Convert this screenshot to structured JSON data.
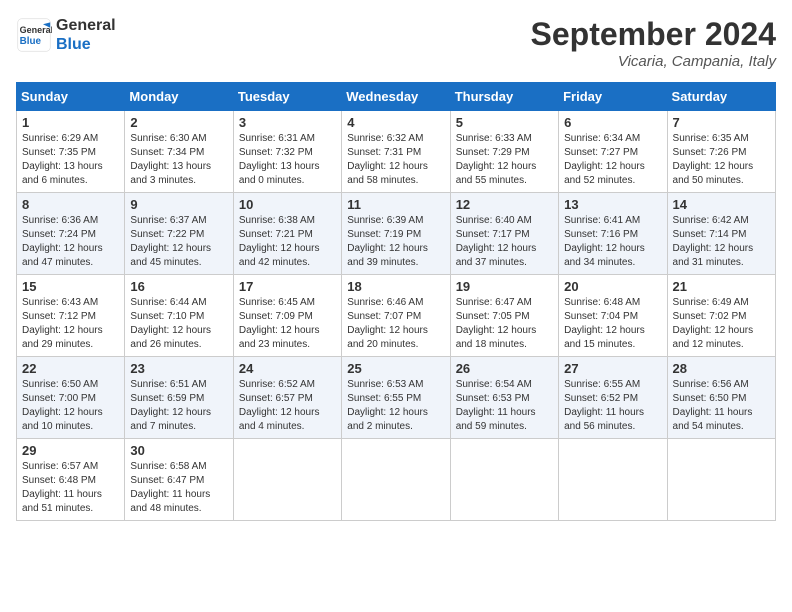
{
  "header": {
    "logo_line1": "General",
    "logo_line2": "Blue",
    "month": "September 2024",
    "location": "Vicaria, Campania, Italy"
  },
  "columns": [
    "Sunday",
    "Monday",
    "Tuesday",
    "Wednesday",
    "Thursday",
    "Friday",
    "Saturday"
  ],
  "weeks": [
    [
      {
        "day": "1",
        "sunrise": "6:29 AM",
        "sunset": "7:35 PM",
        "daylight": "13 hours and 6 minutes."
      },
      {
        "day": "2",
        "sunrise": "6:30 AM",
        "sunset": "7:34 PM",
        "daylight": "13 hours and 3 minutes."
      },
      {
        "day": "3",
        "sunrise": "6:31 AM",
        "sunset": "7:32 PM",
        "daylight": "13 hours and 0 minutes."
      },
      {
        "day": "4",
        "sunrise": "6:32 AM",
        "sunset": "7:31 PM",
        "daylight": "12 hours and 58 minutes."
      },
      {
        "day": "5",
        "sunrise": "6:33 AM",
        "sunset": "7:29 PM",
        "daylight": "12 hours and 55 minutes."
      },
      {
        "day": "6",
        "sunrise": "6:34 AM",
        "sunset": "7:27 PM",
        "daylight": "12 hours and 52 minutes."
      },
      {
        "day": "7",
        "sunrise": "6:35 AM",
        "sunset": "7:26 PM",
        "daylight": "12 hours and 50 minutes."
      }
    ],
    [
      {
        "day": "8",
        "sunrise": "6:36 AM",
        "sunset": "7:24 PM",
        "daylight": "12 hours and 47 minutes."
      },
      {
        "day": "9",
        "sunrise": "6:37 AM",
        "sunset": "7:22 PM",
        "daylight": "12 hours and 45 minutes."
      },
      {
        "day": "10",
        "sunrise": "6:38 AM",
        "sunset": "7:21 PM",
        "daylight": "12 hours and 42 minutes."
      },
      {
        "day": "11",
        "sunrise": "6:39 AM",
        "sunset": "7:19 PM",
        "daylight": "12 hours and 39 minutes."
      },
      {
        "day": "12",
        "sunrise": "6:40 AM",
        "sunset": "7:17 PM",
        "daylight": "12 hours and 37 minutes."
      },
      {
        "day": "13",
        "sunrise": "6:41 AM",
        "sunset": "7:16 PM",
        "daylight": "12 hours and 34 minutes."
      },
      {
        "day": "14",
        "sunrise": "6:42 AM",
        "sunset": "7:14 PM",
        "daylight": "12 hours and 31 minutes."
      }
    ],
    [
      {
        "day": "15",
        "sunrise": "6:43 AM",
        "sunset": "7:12 PM",
        "daylight": "12 hours and 29 minutes."
      },
      {
        "day": "16",
        "sunrise": "6:44 AM",
        "sunset": "7:10 PM",
        "daylight": "12 hours and 26 minutes."
      },
      {
        "day": "17",
        "sunrise": "6:45 AM",
        "sunset": "7:09 PM",
        "daylight": "12 hours and 23 minutes."
      },
      {
        "day": "18",
        "sunrise": "6:46 AM",
        "sunset": "7:07 PM",
        "daylight": "12 hours and 20 minutes."
      },
      {
        "day": "19",
        "sunrise": "6:47 AM",
        "sunset": "7:05 PM",
        "daylight": "12 hours and 18 minutes."
      },
      {
        "day": "20",
        "sunrise": "6:48 AM",
        "sunset": "7:04 PM",
        "daylight": "12 hours and 15 minutes."
      },
      {
        "day": "21",
        "sunrise": "6:49 AM",
        "sunset": "7:02 PM",
        "daylight": "12 hours and 12 minutes."
      }
    ],
    [
      {
        "day": "22",
        "sunrise": "6:50 AM",
        "sunset": "7:00 PM",
        "daylight": "12 hours and 10 minutes."
      },
      {
        "day": "23",
        "sunrise": "6:51 AM",
        "sunset": "6:59 PM",
        "daylight": "12 hours and 7 minutes."
      },
      {
        "day": "24",
        "sunrise": "6:52 AM",
        "sunset": "6:57 PM",
        "daylight": "12 hours and 4 minutes."
      },
      {
        "day": "25",
        "sunrise": "6:53 AM",
        "sunset": "6:55 PM",
        "daylight": "12 hours and 2 minutes."
      },
      {
        "day": "26",
        "sunrise": "6:54 AM",
        "sunset": "6:53 PM",
        "daylight": "11 hours and 59 minutes."
      },
      {
        "day": "27",
        "sunrise": "6:55 AM",
        "sunset": "6:52 PM",
        "daylight": "11 hours and 56 minutes."
      },
      {
        "day": "28",
        "sunrise": "6:56 AM",
        "sunset": "6:50 PM",
        "daylight": "11 hours and 54 minutes."
      }
    ],
    [
      {
        "day": "29",
        "sunrise": "6:57 AM",
        "sunset": "6:48 PM",
        "daylight": "11 hours and 51 minutes."
      },
      {
        "day": "30",
        "sunrise": "6:58 AM",
        "sunset": "6:47 PM",
        "daylight": "11 hours and 48 minutes."
      },
      null,
      null,
      null,
      null,
      null
    ]
  ]
}
